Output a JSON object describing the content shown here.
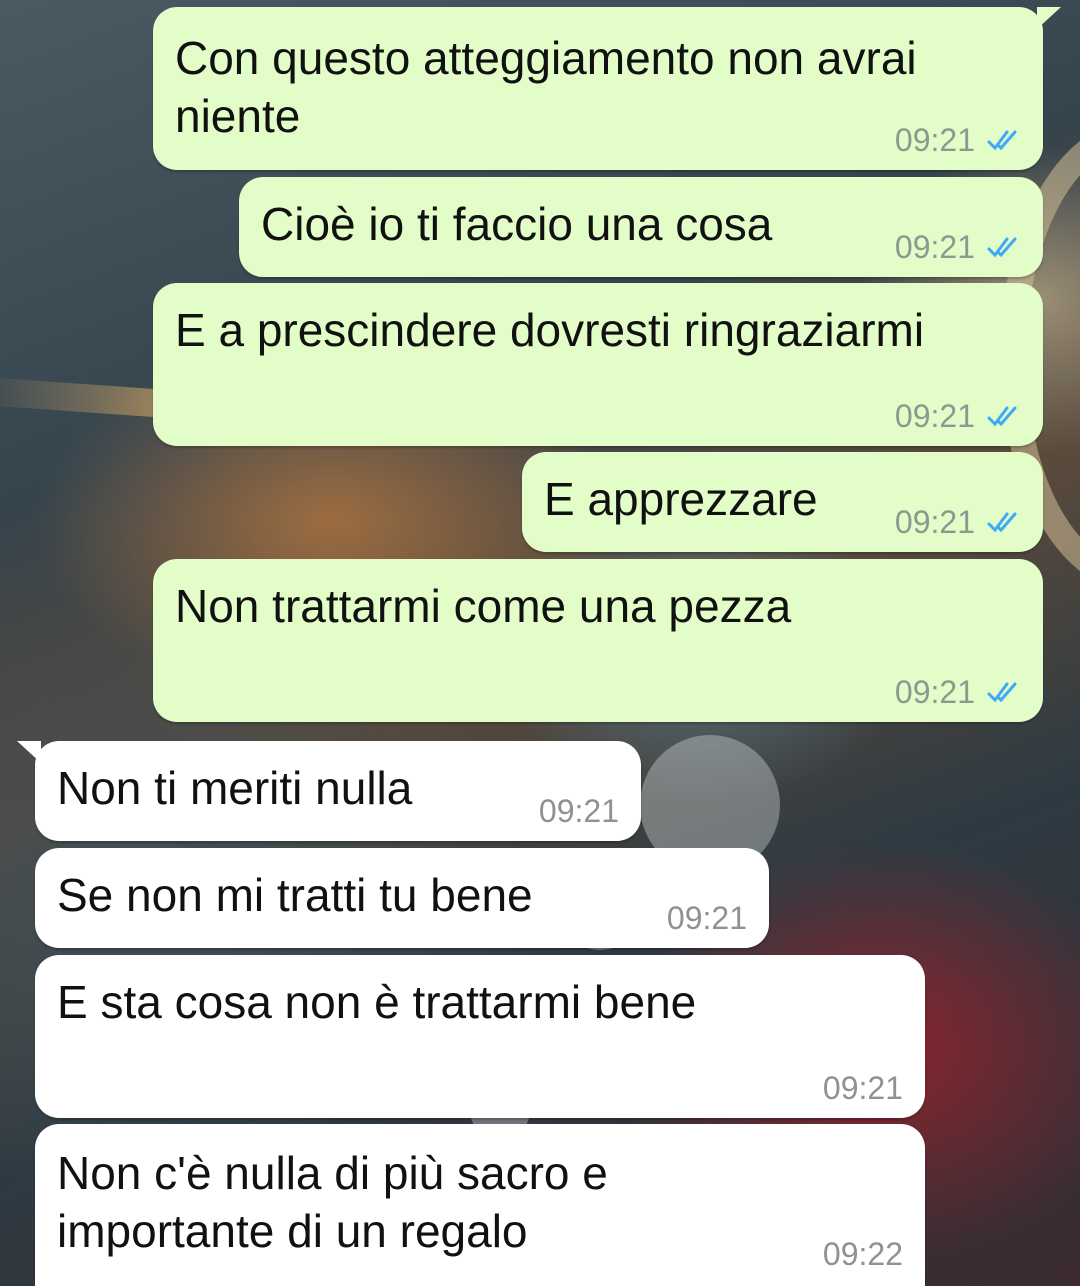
{
  "chat": {
    "messages": [
      {
        "text": "Con questo atteggiamento non avrai\nniente",
        "time": "09:21",
        "direction": "outgoing",
        "status_icon": "double-check-read-icon"
      },
      {
        "text": "Cioè io ti faccio una cosa",
        "time": "09:21",
        "direction": "outgoing",
        "status_icon": "double-check-read-icon"
      },
      {
        "text": "E a prescindere dovresti ringraziarmi",
        "time": "09:21",
        "direction": "outgoing",
        "status_icon": "double-check-read-icon"
      },
      {
        "text": "E apprezzare",
        "time": "09:21",
        "direction": "outgoing",
        "status_icon": "double-check-read-icon"
      },
      {
        "text": "Non trattarmi come una pezza",
        "time": "09:21",
        "direction": "outgoing",
        "status_icon": "double-check-read-icon"
      },
      {
        "text": "Non ti meriti nulla",
        "time": "09:21",
        "direction": "incoming"
      },
      {
        "text": "Se non mi tratti tu bene",
        "time": "09:21",
        "direction": "incoming"
      },
      {
        "text": "E sta cosa non è trattarmi bene",
        "time": "09:21",
        "direction": "incoming"
      },
      {
        "text": "Non c'è nulla di più sacro e\nimportante di un regalo",
        "time": "09:22",
        "direction": "incoming"
      }
    ]
  },
  "colors": {
    "outgoing_bubble": "#e2fdc8",
    "incoming_bubble": "#ffffff",
    "read_tick": "#3fa9f5",
    "time_text": "#8a9a90"
  }
}
